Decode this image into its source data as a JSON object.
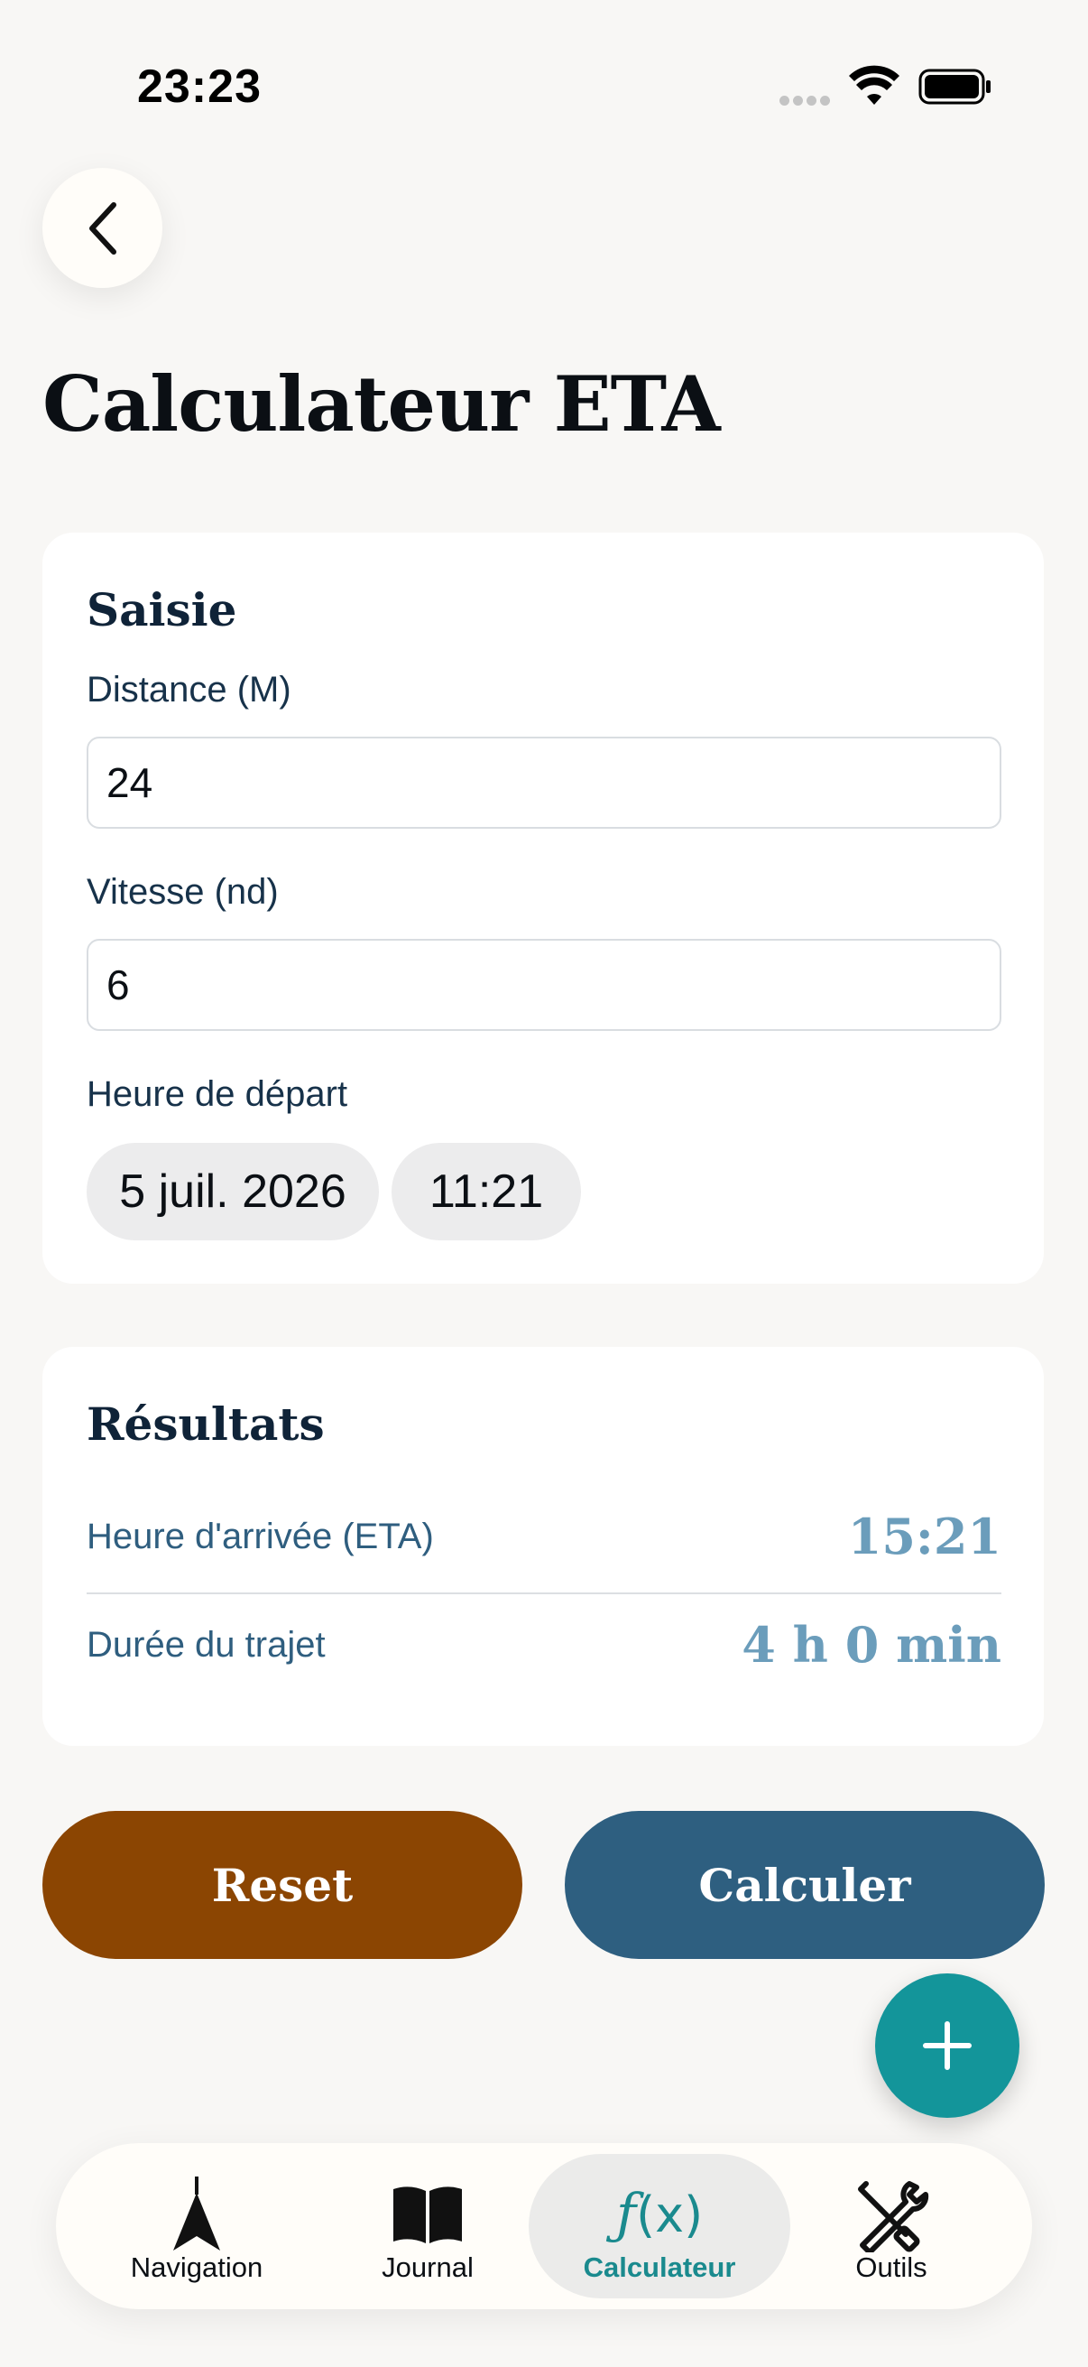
{
  "status_bar": {
    "time": "23:23"
  },
  "page": {
    "title": "Calculateur ETA"
  },
  "input_card": {
    "title": "Saisie",
    "distance_label": "Distance (M)",
    "distance_value": "24",
    "speed_label": "Vitesse (nd)",
    "speed_value": "6",
    "departure_label": "Heure de départ",
    "departure_date": "5 juil. 2026",
    "departure_time": "11:21"
  },
  "results_card": {
    "title": "Résultats",
    "eta_label": "Heure d'arrivée (ETA)",
    "eta_value": "15:21",
    "duration_label": "Durée du trajet",
    "duration_value": "4 h 0 min"
  },
  "actions": {
    "reset_label": "Reset",
    "calculate_label": "Calculer"
  },
  "tab_bar": {
    "items": [
      {
        "label": "Navigation",
        "icon": "navigation-arrow-icon"
      },
      {
        "label": "Journal",
        "icon": "book-icon"
      },
      {
        "label": "Calculateur",
        "icon": "function-icon",
        "active": true
      },
      {
        "label": "Outils",
        "icon": "tools-icon"
      }
    ]
  },
  "colors": {
    "background": "#f8f7f5",
    "reset": "#8b4502",
    "calculate": "#2e5f80",
    "fab": "#13959a",
    "active_tab": "#1a8a8e",
    "result_value": "#6b9dbb"
  }
}
